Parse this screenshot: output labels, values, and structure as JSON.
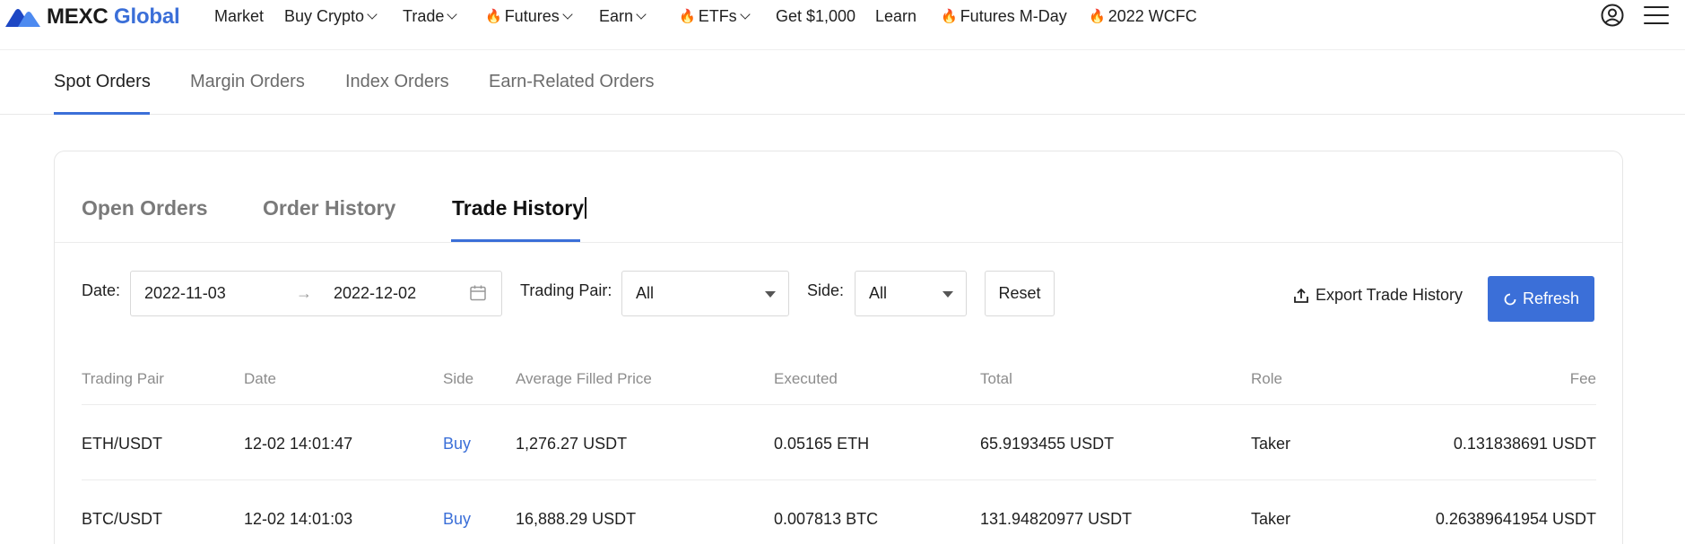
{
  "navbar": {
    "logo_main": "MEXC",
    "logo_sub": "Global",
    "items": [
      {
        "label": "Market",
        "fire": false,
        "dropdown": false
      },
      {
        "label": "Buy Crypto",
        "fire": false,
        "dropdown": true
      },
      {
        "label": "Trade",
        "fire": false,
        "dropdown": true
      },
      {
        "label": "Futures",
        "fire": true,
        "dropdown": true
      },
      {
        "label": "Earn",
        "fire": false,
        "dropdown": true
      },
      {
        "label": "ETFs",
        "fire": true,
        "dropdown": true
      },
      {
        "label": "Get $1,000",
        "fire": false,
        "dropdown": false
      },
      {
        "label": "Learn",
        "fire": false,
        "dropdown": false
      },
      {
        "label": "Futures M-Day",
        "fire": true,
        "dropdown": false
      },
      {
        "label": "2022 WCFC",
        "fire": true,
        "dropdown": false
      }
    ],
    "icons": {
      "user": "user-circle-icon",
      "menu": "hamburger-menu-icon"
    }
  },
  "order_tabs": {
    "items": [
      "Spot Orders",
      "Margin Orders",
      "Index Orders",
      "Earn-Related Orders"
    ],
    "active": "Spot Orders"
  },
  "sub_tabs": {
    "items": [
      "Open Orders",
      "Order History",
      "Trade History"
    ],
    "active": "Trade History"
  },
  "filters": {
    "date_label": "Date",
    "date_start": "2022-11-03",
    "date_end": "2022-12-02",
    "date_arrow": "→",
    "pair_label": "Trading Pair",
    "pair_value": "All",
    "side_label": "Side",
    "side_value": "All",
    "reset_label": "Reset",
    "export_label": "Export Trade History",
    "refresh_label": "Refresh",
    "label_colon": ":"
  },
  "table": {
    "columns": [
      "Trading Pair",
      "Date",
      "Side",
      "Average Filled Price",
      "Executed",
      "Total",
      "Role",
      "Fee"
    ],
    "rows": [
      {
        "pair": "ETH/USDT",
        "date": "12-02 14:01:47",
        "side": "Buy",
        "avg_price": "1,276.27 USDT",
        "executed": "0.05165 ETH",
        "total": "65.9193455 USDT",
        "role": "Taker",
        "fee": "0.131838691 USDT"
      },
      {
        "pair": "BTC/USDT",
        "date": "12-02 14:01:03",
        "side": "Buy",
        "avg_price": "16,888.29 USDT",
        "executed": "0.007813 BTC",
        "total": "131.94820977 USDT",
        "role": "Taker",
        "fee": "0.26389641954 USDT"
      }
    ]
  },
  "colors": {
    "accent": "#3b6fd8",
    "fire": "#f05a1a",
    "text": "#1f1f1f",
    "muted": "#8c8c8c"
  }
}
